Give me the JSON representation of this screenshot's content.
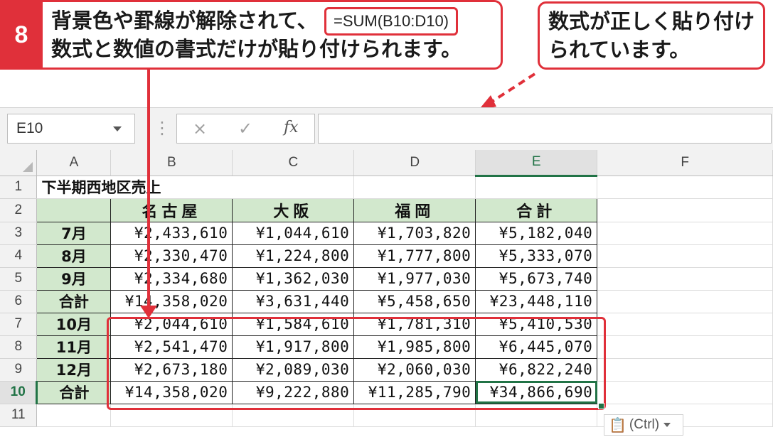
{
  "callouts": {
    "step_number": "8",
    "left_line1": "背景色や罫線が解除されて、",
    "left_line2": "数式と数値の書式だけが貼り付けられます。",
    "right_line1": "数式が正しく貼り付け",
    "right_line2": "られています。"
  },
  "formula_bar": {
    "name_box": "E10",
    "cancel_icon": "×",
    "enter_icon": "✓",
    "fx_label": "fx",
    "formula": "=SUM(B10:D10)"
  },
  "columns": [
    "A",
    "B",
    "C",
    "D",
    "E",
    "F"
  ],
  "selected_column": "E",
  "selected_row": "10",
  "row_numbers": [
    "1",
    "2",
    "3",
    "4",
    "5",
    "6",
    "7",
    "8",
    "9",
    "10",
    "11"
  ],
  "sheet": {
    "title": "下半期西地区売上",
    "headers": [
      "名古屋",
      "大阪",
      "福岡",
      "合計"
    ],
    "rows": [
      {
        "label": "7月",
        "values": [
          "¥2,433,610",
          "¥1,044,610",
          "¥1,703,820",
          "¥5,182,040"
        ]
      },
      {
        "label": "8月",
        "values": [
          "¥2,330,470",
          "¥1,224,800",
          "¥1,777,800",
          "¥5,333,070"
        ]
      },
      {
        "label": "9月",
        "values": [
          "¥2,334,680",
          "¥1,362,030",
          "¥1,977,030",
          "¥5,673,740"
        ]
      },
      {
        "label": "合計",
        "values": [
          "¥14,358,020",
          "¥3,631,440",
          "¥5,458,650",
          "¥23,448,110"
        ]
      },
      {
        "label": "10月",
        "values": [
          "¥2,044,610",
          "¥1,584,610",
          "¥1,781,310",
          "¥5,410,530"
        ]
      },
      {
        "label": "11月",
        "values": [
          "¥2,541,470",
          "¥1,917,800",
          "¥1,985,800",
          "¥6,445,070"
        ]
      },
      {
        "label": "12月",
        "values": [
          "¥2,673,180",
          "¥2,089,030",
          "¥2,060,030",
          "¥6,822,240"
        ]
      },
      {
        "label": "合計",
        "values": [
          "¥14,358,020",
          "¥9,222,880",
          "¥11,285,790",
          "¥34,866,690"
        ]
      }
    ]
  },
  "paste_options_label": "(Ctrl)",
  "colors": {
    "accent_red": "#e0303a",
    "excel_green": "#217346",
    "header_fill": "#d2e8cd"
  }
}
